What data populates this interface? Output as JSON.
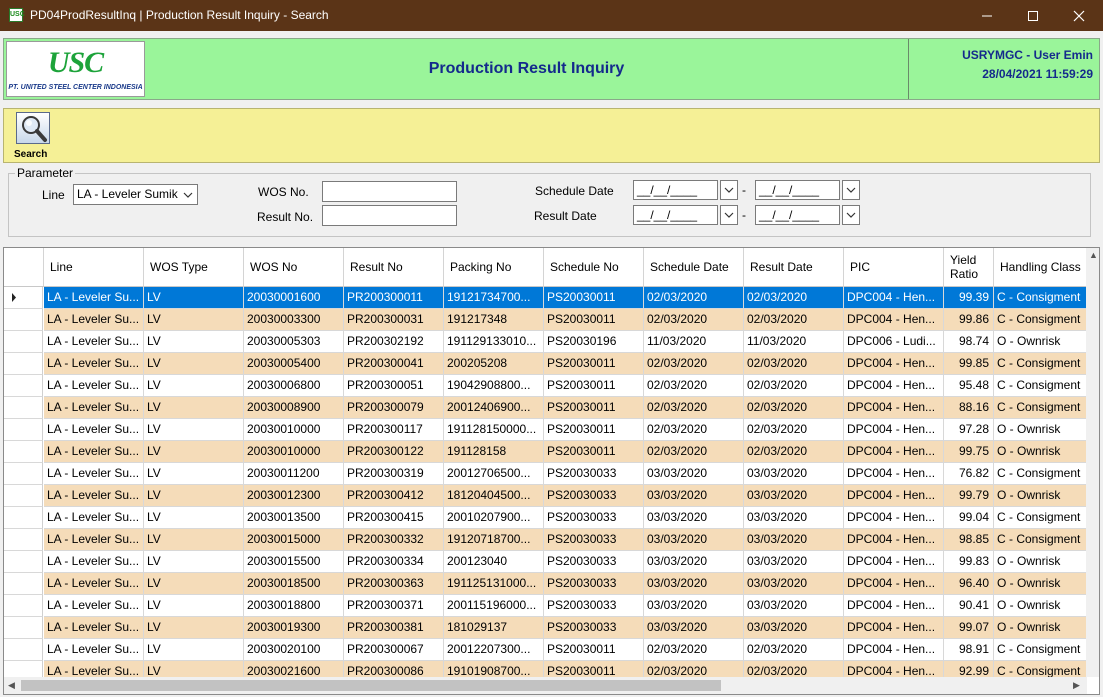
{
  "window": {
    "title": "PD04ProdResultInq | Production Result Inquiry - Search",
    "icon_label": "USC"
  },
  "header": {
    "logo_text": "USC",
    "logo_subtext": "PT. UNITED STEEL CENTER INDONESIA",
    "title": "Production Result Inquiry",
    "user": "USRYMGC - User Emin",
    "datetime": "28/04/2021 11:59:29"
  },
  "toolbar": {
    "search_label": "Search"
  },
  "parameter": {
    "legend": "Parameter",
    "line_label": "Line",
    "line_value": "LA - Leveler Sumik",
    "wos_label": "WOS No.",
    "result_label": "Result No.",
    "schedule_date_label": "Schedule Date",
    "result_date_label": "Result Date",
    "date_placeholder": "__/__/____",
    "separator": "-"
  },
  "grid": {
    "columns": [
      "Line",
      "WOS Type",
      "WOS No",
      "Result No",
      "Packing No",
      "Schedule No",
      "Schedule Date",
      "Result Date",
      "PIC",
      "Yield Ratio",
      "Handling Class"
    ],
    "rows": [
      [
        "LA - Leveler Su...",
        "LV",
        "20030001600",
        "PR200300011",
        "19121734700...",
        "PS20030011",
        "02/03/2020",
        "02/03/2020",
        "DPC004 - Hen...",
        "99.39",
        "C - Consigment"
      ],
      [
        "LA - Leveler Su...",
        "LV",
        "20030003300",
        "PR200300031",
        "191217348",
        "PS20030011",
        "02/03/2020",
        "02/03/2020",
        "DPC004 - Hen...",
        "99.86",
        "C - Consigment"
      ],
      [
        "LA - Leveler Su...",
        "LV",
        "20030005303",
        "PR200302192",
        "191129133010...",
        "PS20030196",
        "11/03/2020",
        "11/03/2020",
        "DPC006 - Ludi...",
        "98.74",
        "O - Ownrisk"
      ],
      [
        "LA - Leveler Su...",
        "LV",
        "20030005400",
        "PR200300041",
        "200205208",
        "PS20030011",
        "02/03/2020",
        "02/03/2020",
        "DPC004 - Hen...",
        "99.85",
        "C - Consigment"
      ],
      [
        "LA - Leveler Su...",
        "LV",
        "20030006800",
        "PR200300051",
        "19042908800...",
        "PS20030011",
        "02/03/2020",
        "02/03/2020",
        "DPC004 - Hen...",
        "95.48",
        "C - Consigment"
      ],
      [
        "LA - Leveler Su...",
        "LV",
        "20030008900",
        "PR200300079",
        "20012406900...",
        "PS20030011",
        "02/03/2020",
        "02/03/2020",
        "DPC004 - Hen...",
        "88.16",
        "C - Consigment"
      ],
      [
        "LA - Leveler Su...",
        "LV",
        "20030010000",
        "PR200300117",
        "191128150000...",
        "PS20030011",
        "02/03/2020",
        "02/03/2020",
        "DPC004 - Hen...",
        "97.28",
        "O - Ownrisk"
      ],
      [
        "LA - Leveler Su...",
        "LV",
        "20030010000",
        "PR200300122",
        "191128158",
        "PS20030011",
        "02/03/2020",
        "02/03/2020",
        "DPC004 - Hen...",
        "99.75",
        "O - Ownrisk"
      ],
      [
        "LA - Leveler Su...",
        "LV",
        "20030011200",
        "PR200300319",
        "20012706500...",
        "PS20030033",
        "03/03/2020",
        "03/03/2020",
        "DPC004 - Hen...",
        "76.82",
        "C - Consigment"
      ],
      [
        "LA - Leveler Su...",
        "LV",
        "20030012300",
        "PR200300412",
        "18120404500...",
        "PS20030033",
        "03/03/2020",
        "03/03/2020",
        "DPC004 - Hen...",
        "99.79",
        "O - Ownrisk"
      ],
      [
        "LA - Leveler Su...",
        "LV",
        "20030013500",
        "PR200300415",
        "20010207900...",
        "PS20030033",
        "03/03/2020",
        "03/03/2020",
        "DPC004 - Hen...",
        "99.04",
        "C - Consigment"
      ],
      [
        "LA - Leveler Su...",
        "LV",
        "20030015000",
        "PR200300332",
        "19120718700...",
        "PS20030033",
        "03/03/2020",
        "03/03/2020",
        "DPC004 - Hen...",
        "98.85",
        "C - Consigment"
      ],
      [
        "LA - Leveler Su...",
        "LV",
        "20030015500",
        "PR200300334",
        "200123040",
        "PS20030033",
        "03/03/2020",
        "03/03/2020",
        "DPC004 - Hen...",
        "99.83",
        "O - Ownrisk"
      ],
      [
        "LA - Leveler Su...",
        "LV",
        "20030018500",
        "PR200300363",
        "191125131000...",
        "PS20030033",
        "03/03/2020",
        "03/03/2020",
        "DPC004 - Hen...",
        "96.40",
        "O - Ownrisk"
      ],
      [
        "LA - Leveler Su...",
        "LV",
        "20030018800",
        "PR200300371",
        "200115196000...",
        "PS20030033",
        "03/03/2020",
        "03/03/2020",
        "DPC004 - Hen...",
        "90.41",
        "O - Ownrisk"
      ],
      [
        "LA - Leveler Su...",
        "LV",
        "20030019300",
        "PR200300381",
        "181029137",
        "PS20030033",
        "03/03/2020",
        "03/03/2020",
        "DPC004 - Hen...",
        "99.07",
        "O - Ownrisk"
      ],
      [
        "LA - Leveler Su...",
        "LV",
        "20030020100",
        "PR200300067",
        "20012207300...",
        "PS20030011",
        "02/03/2020",
        "02/03/2020",
        "DPC004 - Hen...",
        "98.91",
        "C - Consigment"
      ],
      [
        "LA - Leveler Su...",
        "LV",
        "20030021600",
        "PR200300086",
        "19101908700...",
        "PS20030011",
        "02/03/2020",
        "02/03/2020",
        "DPC004 - Hen...",
        "92.99",
        "C - Consigment"
      ]
    ]
  },
  "colors": {
    "titlebar": "#5b3417",
    "header_bg": "#9af59a",
    "toolbar_bg": "#f5f096",
    "row_alt": "#f5dcb9",
    "row_selected": "#0078d7",
    "title_text": "#142a8c"
  }
}
